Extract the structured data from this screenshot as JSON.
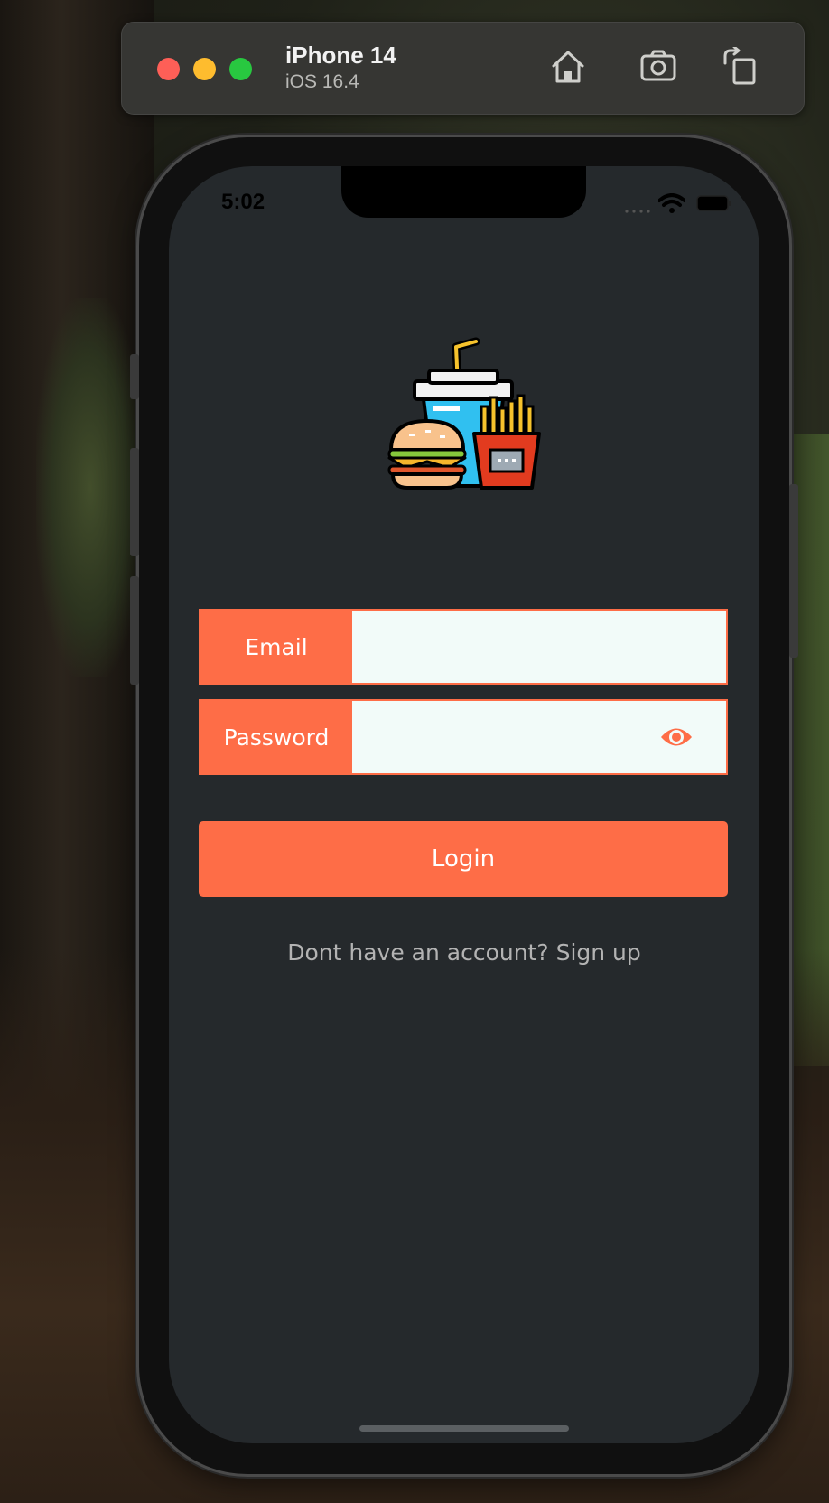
{
  "toolbar": {
    "device_name": "iPhone 14",
    "os_version": "iOS 16.4",
    "icons": [
      "home-icon",
      "screenshot-icon",
      "rotate-icon"
    ]
  },
  "status_bar": {
    "time": "5:02"
  },
  "login": {
    "email_label": "Email",
    "email_value": "",
    "password_label": "Password",
    "password_value": "",
    "login_button": "Login",
    "signup_text": "Dont have an account? Sign up"
  },
  "colors": {
    "accent": "#fe6d47",
    "screen_background": "#25292c",
    "input_background": "#f2fbf9",
    "muted_text": "#b3b3b3"
  }
}
